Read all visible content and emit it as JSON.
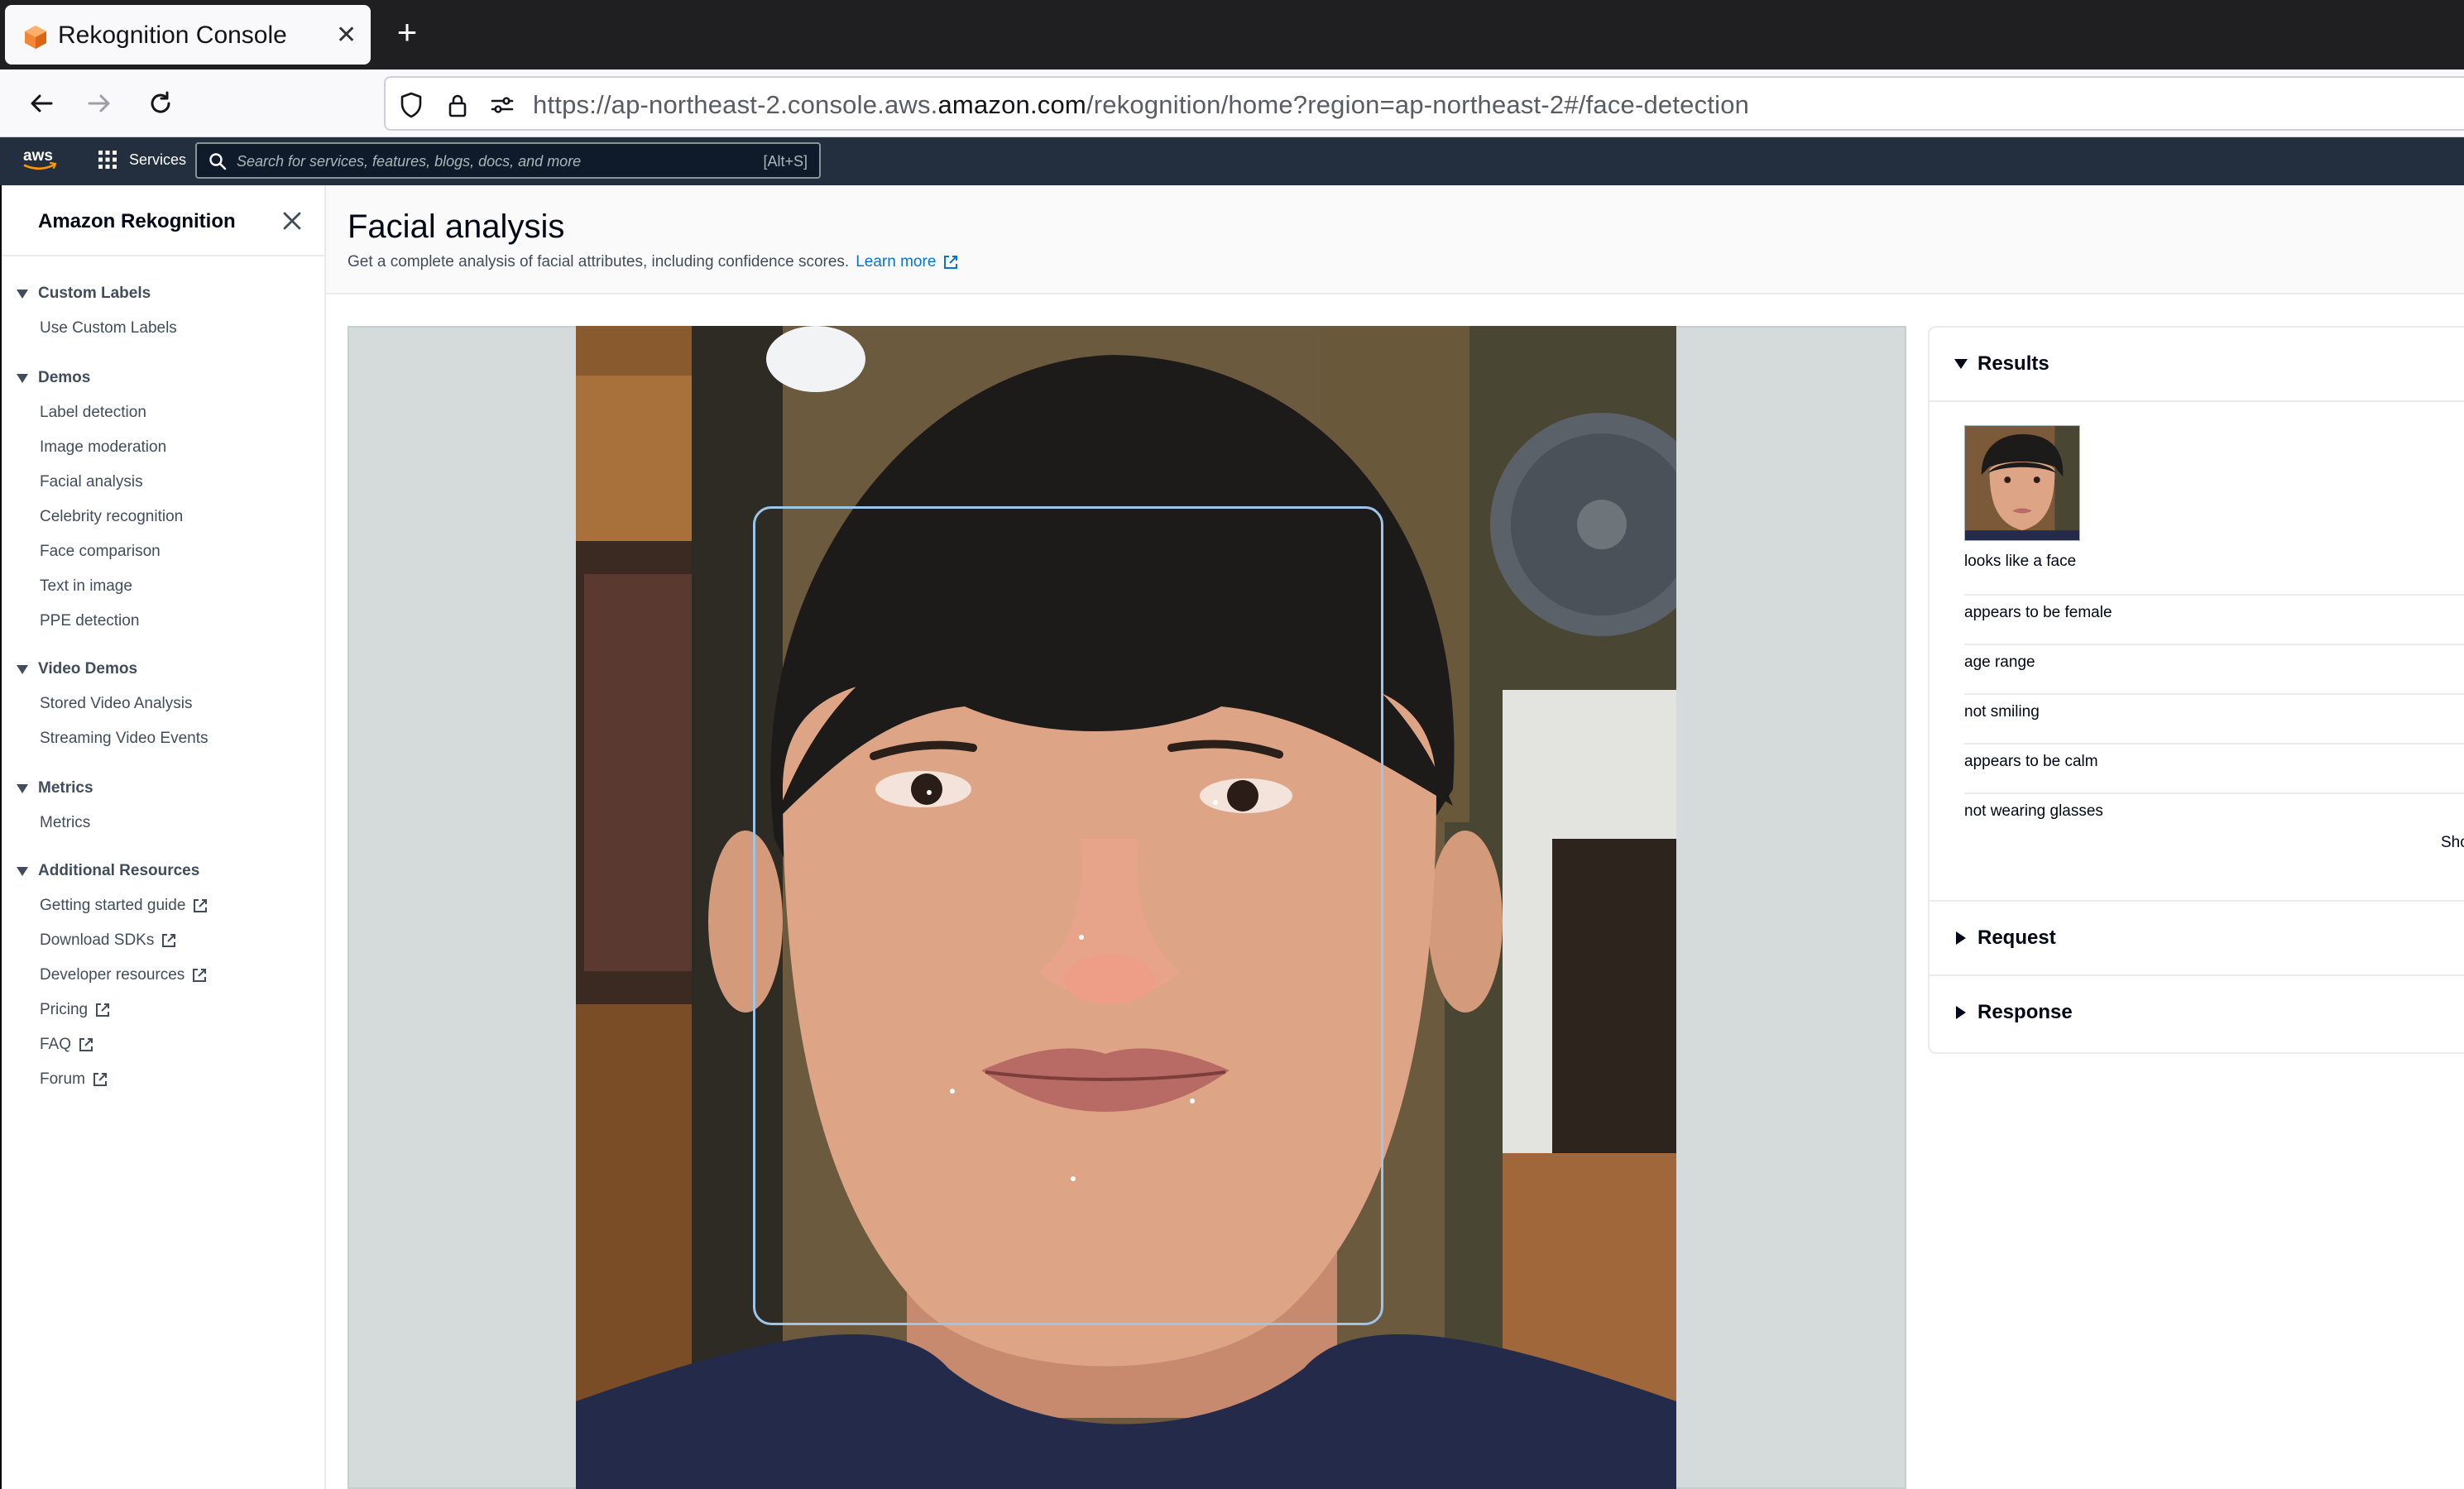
{
  "browser": {
    "tab_title": "Rekognition Console",
    "url_prefix": "https://ap-northeast-2.console.aws.",
    "url_domain": "amazon.com",
    "url_suffix": "/rekognition/home?region=ap-northeast-2#/face-detection"
  },
  "aws_nav": {
    "services_label": "Services",
    "search_placeholder": "Search for services, features, blogs, docs, and more",
    "search_shortcut": "[Alt+S]"
  },
  "sidebar": {
    "title": "Amazon Rekognition",
    "sections": [
      {
        "label": "Custom Labels",
        "items": [
          "Use Custom Labels"
        ]
      },
      {
        "label": "Demos",
        "items": [
          "Label detection",
          "Image moderation",
          "Facial analysis",
          "Celebrity recognition",
          "Face comparison",
          "Text in image",
          "PPE detection"
        ]
      },
      {
        "label": "Video Demos",
        "items": [
          "Stored Video Analysis",
          "Streaming Video Events"
        ]
      },
      {
        "label": "Metrics",
        "items": [
          "Metrics"
        ]
      },
      {
        "label": "Additional Resources",
        "items": [
          "Getting started guide",
          "Download SDKs",
          "Developer resources",
          "Pricing",
          "FAQ",
          "Forum"
        ]
      }
    ]
  },
  "page": {
    "title": "Facial analysis",
    "description": "Get a complete analysis of facial attributes, including confidence scores.",
    "learn_more": "Learn more"
  },
  "results": {
    "title": "Results",
    "items": [
      "looks like a face",
      "appears to be female",
      "age range",
      "not smiling",
      "appears to be calm",
      "not wearing glasses"
    ],
    "show_more": "Sho",
    "request_label": "Request",
    "response_label": "Response"
  }
}
